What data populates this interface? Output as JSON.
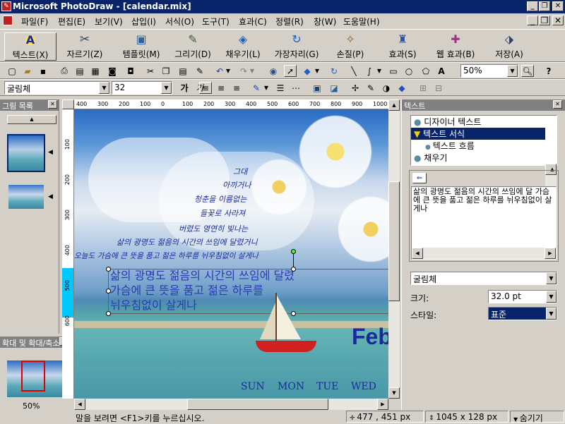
{
  "window": {
    "title": "Microsoft PhotoDraw - [calendar.mix]"
  },
  "menu": {
    "items": [
      "파일(F)",
      "편집(E)",
      "보기(V)",
      "삽입(I)",
      "서식(O)",
      "도구(T)",
      "효과(C)",
      "정렬(R)",
      "창(W)",
      "도움말(H)"
    ]
  },
  "big_toolbar": {
    "buttons": [
      "텍스트(X)",
      "자르기(Z)",
      "템플릿(M)",
      "그리기(D)",
      "채우기(L)",
      "가장자리(G)",
      "손질(P)",
      "효과(S)",
      "웹 효과(B)",
      "저장(A)"
    ]
  },
  "std_toolbar": {
    "zoom": "50%"
  },
  "format_toolbar": {
    "font": "굴림체",
    "size": "32",
    "bold": "가",
    "italic": "가"
  },
  "left_panel": {
    "title": "그림 목록",
    "zoom_title": "확대 및 확대/축소",
    "zoom_value": "50%"
  },
  "ruler": {
    "h_labels": [
      "400",
      "300",
      "200",
      "100",
      "0",
      "100",
      "200",
      "300",
      "400",
      "500",
      "600",
      "700",
      "800",
      "900",
      "1000"
    ],
    "v_labels": [
      "100",
      "200",
      "300",
      "400",
      "500",
      "600"
    ]
  },
  "canvas": {
    "poem_lines": [
      "그대",
      "아끼거나",
      "청춘을 이름없는",
      "들꽃로 사라져",
      "버렸도 영연히 빛나는",
      "삶의 광명도 젊음의 시간의 쓰임에 달렸거니",
      "오늘도 가슴에 큰 뜻을 품고 젊은 하루를 뉘우침없이 살게나"
    ],
    "selected_text_lines": [
      "삶의 광명도 젊음의 시간의 쓰임에 달렸",
      "가슴에 큰 뜻을 품고 젊은 하루를",
      "뉘우침없이 살게나"
    ],
    "month": "Feb",
    "days": [
      "SUN",
      "MON",
      "TUE",
      "WED"
    ]
  },
  "right_panel": {
    "title": "텍스트",
    "list": [
      "디자이너 텍스트",
      "텍스트 서식",
      "텍스트 흐름",
      "채우기"
    ],
    "preview_text": "삶의 광명도 젊음의 시간의 쓰임에 달 가슴에 큰 뜻을 품고 젊은 하루를 뉘우침없이 살게나",
    "font": "굴림체",
    "size_label": "크기:",
    "size_value": "32.0 pt",
    "style_label": "스타일:",
    "style_value": "표준"
  },
  "status": {
    "help": "말을 보려면 <F1>키를 누르십시오.",
    "position": "477 , 451 px",
    "size": "1045 x 128 px",
    "hide": "숨기기"
  },
  "colors": {
    "title_bar": "#0a246a",
    "text_blue": "#1a2a9a",
    "selection": "#0a246a",
    "highlight_strip": "#00c8ff"
  }
}
